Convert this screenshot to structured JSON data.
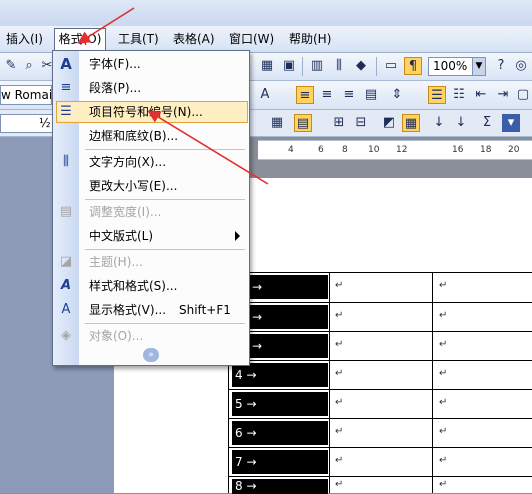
{
  "menubar": {
    "items": [
      "插入(I)",
      "格式(O)",
      "工具(T)",
      "表格(A)",
      "窗口(W)",
      "帮助(H)"
    ]
  },
  "toolbar": {
    "font_name": "w Romai",
    "font_size": "½",
    "zoom": "100%",
    "zoom_arrow": "▼"
  },
  "ruler": {
    "ticks": [
      "4",
      "6",
      "8",
      "10",
      "12",
      "16",
      "18",
      "20"
    ]
  },
  "format_menu": {
    "items": [
      {
        "label": "字体(F)...",
        "icon": "font-icon",
        "glyph": "A",
        "enabled": true
      },
      {
        "label": "段落(P)...",
        "icon": "paragraph-icon",
        "glyph": "≡",
        "enabled": true
      },
      {
        "label": "项目符号和编号(N)...",
        "icon": "bullets-numbering-icon",
        "glyph": "☰",
        "enabled": true,
        "highlighted": true
      },
      {
        "label": "边框和底纹(B)...",
        "icon": "",
        "glyph": "",
        "enabled": true
      },
      {
        "label": "文字方向(X)...",
        "icon": "text-direction-icon",
        "glyph": "⫼",
        "enabled": true
      },
      {
        "label": "更改大小写(E)...",
        "icon": "",
        "glyph": "",
        "enabled": true
      },
      {
        "label": "调整宽度(I)...",
        "icon": "fit-width-icon",
        "glyph": "▤",
        "enabled": false
      },
      {
        "label": "中文版式(L)",
        "icon": "",
        "glyph": "",
        "enabled": true,
        "submenu": true
      },
      {
        "label": "主题(H)...",
        "icon": "theme-icon",
        "glyph": "◪",
        "enabled": false
      },
      {
        "label": "样式和格式(S)...",
        "icon": "styles-icon",
        "glyph": "A",
        "enabled": true
      },
      {
        "label": "显示格式(V)...",
        "icon": "reveal-formatting-icon",
        "glyph": "A",
        "enabled": true,
        "shortcut": "Shift+F1"
      },
      {
        "label": "对象(O)...",
        "icon": "object-icon",
        "glyph": "◈",
        "enabled": false
      }
    ],
    "expand": "»"
  },
  "table": {
    "rows": [
      "4 →",
      "5 →",
      "6 →",
      "7 →",
      "8 →"
    ],
    "cell_mark": "↵"
  },
  "colors": {
    "menu_highlight": "#ffeec2",
    "arrow": "#e03030"
  }
}
